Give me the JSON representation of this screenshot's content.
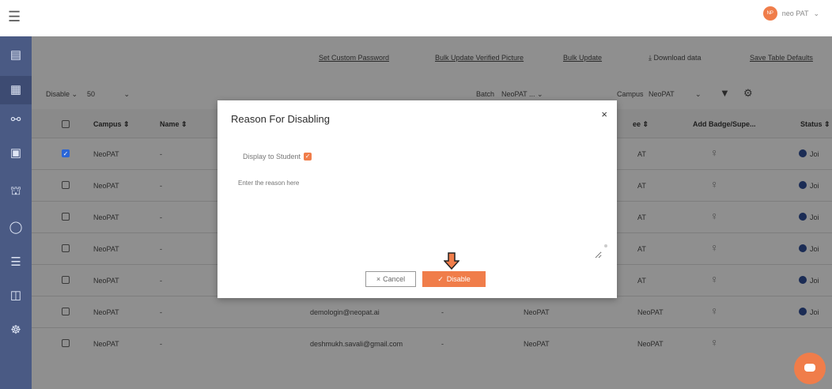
{
  "header": {
    "menu_icon": "hamburger-icon",
    "user_avatar_text": "NP",
    "user_name": "neo PAT",
    "user_chevron": "chevron-down-icon"
  },
  "sidebar": {
    "items": [
      {
        "icon": "document-icon"
      },
      {
        "icon": "clipboard-icon"
      },
      {
        "icon": "network-icon"
      },
      {
        "icon": "briefcase-icon"
      },
      {
        "icon": "bank-icon"
      },
      {
        "icon": "shield-icon"
      },
      {
        "icon": "notes-icon"
      },
      {
        "icon": "cart-icon"
      },
      {
        "icon": "globe-icon"
      }
    ]
  },
  "toolbar": {
    "links": [
      "Set Custom Password",
      "Bulk Update Verified Picture",
      "Bulk Update",
      "Download data",
      "Save Table Defaults"
    ],
    "action_select": "Disable",
    "page_size": "50",
    "batch_label": "Batch",
    "batch_value": "NeoPAT ...",
    "campus_label": "Campus",
    "campus_value": "NeoPAT"
  },
  "table": {
    "headers": [
      "Campus ⇕",
      "Name ⇕",
      "ee ⇕",
      "Add Badge/Supe...",
      "Status ⇕"
    ],
    "rows": [
      {
        "campus": "NeoPAT",
        "name": "-",
        "email": "",
        "col4": "",
        "col5": "",
        "col6": "AT",
        "checked": true,
        "status": "Joi"
      },
      {
        "campus": "NeoPAT",
        "name": "-",
        "email": "",
        "col4": "",
        "col5": "",
        "col6": "AT",
        "checked": false,
        "status": "Joi"
      },
      {
        "campus": "NeoPAT",
        "name": "-",
        "email": "",
        "col4": "",
        "col5": "",
        "col6": "AT",
        "checked": false,
        "status": "Joi"
      },
      {
        "campus": "NeoPAT",
        "name": "-",
        "email": "",
        "col4": "",
        "col5": "",
        "col6": "AT",
        "checked": false,
        "status": "Joi"
      },
      {
        "campus": "NeoPAT",
        "name": "-",
        "email": "",
        "col4": "",
        "col5": "",
        "col6": "AT",
        "checked": false,
        "status": "Joi"
      },
      {
        "campus": "NeoPAT",
        "name": "-",
        "email": "demologin@neopat.ai",
        "col4": "-",
        "col5": "NeoPAT",
        "col6": "NeoPAT",
        "checked": false,
        "status": "Joi"
      },
      {
        "campus": "NeoPAT",
        "name": "-",
        "email": "deshmukh.savali@gmail.com",
        "col4": "-",
        "col5": "NeoPAT",
        "col6": "NeoPAT",
        "checked": false,
        "status": ""
      }
    ]
  },
  "modal": {
    "title": "Reason For Disabling",
    "close": "×",
    "display_label": "Display to Student",
    "reason_placeholder": "Enter the reason here",
    "cancel_label": "Cancel",
    "disable_label": "Disable"
  },
  "colors": {
    "accent": "#f07d4a",
    "sidebar": "#4a5a84",
    "checkbox_checked": "#2b66d6"
  }
}
